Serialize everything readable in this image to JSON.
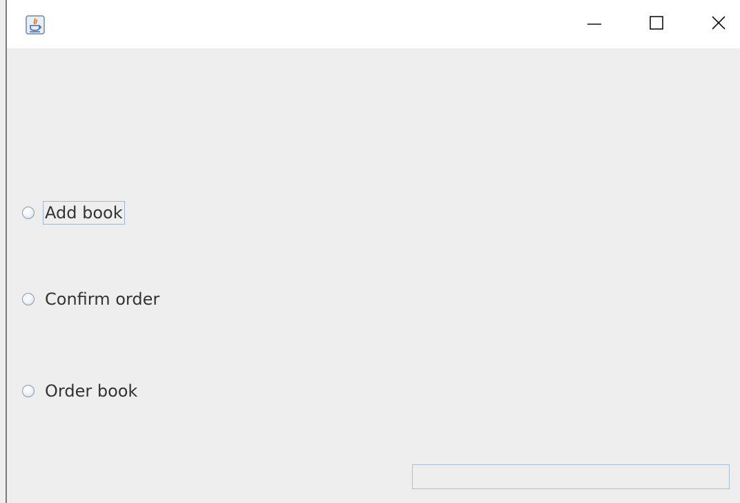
{
  "window": {
    "icon": "java-cup-icon",
    "title": "",
    "controls": {
      "minimize": "minimize-icon",
      "maximize": "maximize-icon",
      "close": "close-icon"
    }
  },
  "options": [
    {
      "label": "Add book",
      "selected": false,
      "focused": true
    },
    {
      "label": "Confirm order",
      "selected": false,
      "focused": false
    },
    {
      "label": "Order book",
      "selected": false,
      "focused": false
    }
  ],
  "text_field": {
    "value": "",
    "placeholder": ""
  },
  "colors": {
    "content_background": "#eeeeee",
    "titlebar_background": "#ffffff",
    "focus_border": "#a3b8cc",
    "field_border": "#a9bfd6"
  }
}
